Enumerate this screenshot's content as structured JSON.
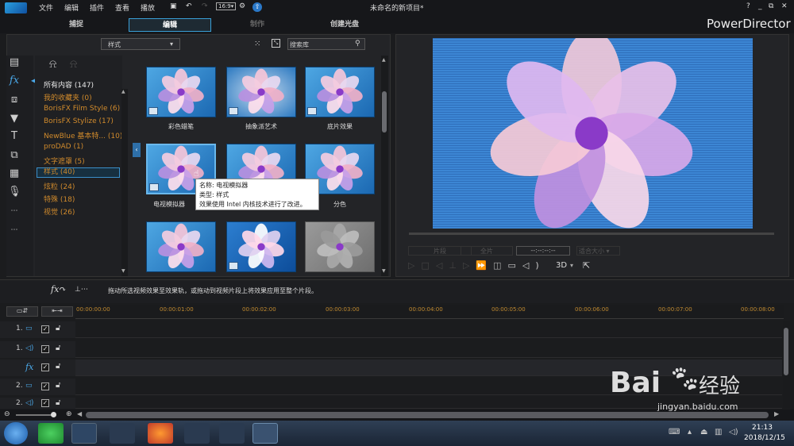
{
  "app": {
    "title": "未命名的新项目*",
    "brand": "PowerDirector",
    "menus": [
      "文件",
      "编辑",
      "插件",
      "查看",
      "播放"
    ],
    "window_buttons": [
      "?",
      "_",
      "⧉",
      "✕"
    ]
  },
  "tabs": [
    {
      "label": "捕捉"
    },
    {
      "label": "编辑"
    },
    {
      "label": "制作"
    },
    {
      "label": "创建光盘"
    }
  ],
  "library": {
    "filter_value": "样式",
    "search_placeholder": "搜索库",
    "categories": [
      {
        "label": "所有内容 (147)"
      },
      {
        "label": "我的收藏夹  (0)"
      },
      {
        "label": "BorisFX Film Style  (6)"
      },
      {
        "label": "BorisFX Stylize  (17)"
      },
      {
        "label": "NewBlue 基本特...  (10)"
      },
      {
        "label": "proDAD  (1)"
      },
      {
        "label": "文字遮罩  (5)"
      },
      {
        "label": "样式  (40)"
      },
      {
        "label": "炫粒  (24)"
      },
      {
        "label": "特殊  (18)"
      },
      {
        "label": "视觉  (26)"
      }
    ],
    "thumbs": [
      {
        "label": "彩色蜡笔"
      },
      {
        "label": "抽象派艺术"
      },
      {
        "label": "底片效果"
      },
      {
        "label": "电视模拟器"
      },
      {
        "label": ""
      },
      {
        "label": "分色"
      },
      {
        "label": ""
      },
      {
        "label": ""
      },
      {
        "label": ""
      }
    ],
    "tooltip": {
      "name": "名称: 电视模拟器",
      "type": "类型: 样式",
      "desc": "效果使用 Intel 内核技术进行了改进。"
    }
  },
  "preview": {
    "clip_btn": "片段",
    "full_btn": "全片",
    "timecode": "--:--:--:--",
    "fit_label": "适合大小",
    "three_d": "3D"
  },
  "hint": "拖动所选视频效果至效果轨，或拖动到视频片段上将效果应用至整个片段。",
  "ruler": [
    "00:00:00:00",
    "00:00:01:00",
    "00:00:02:00",
    "00:00:03:00",
    "00:00:04:00",
    "00:00:05:00",
    "00:00:06:00",
    "00:00:07:00",
    "00:00:08:00"
  ],
  "tracks": [
    {
      "num": "1."
    },
    {
      "num": "1."
    },
    {
      "num": ""
    },
    {
      "num": "2."
    },
    {
      "num": "2."
    }
  ],
  "taskbar": {
    "time": "21:13",
    "date": "2018/12/15"
  },
  "watermark": {
    "brand": "Bai",
    "brand2": "经验",
    "url": "jingyan.baidu.com"
  }
}
